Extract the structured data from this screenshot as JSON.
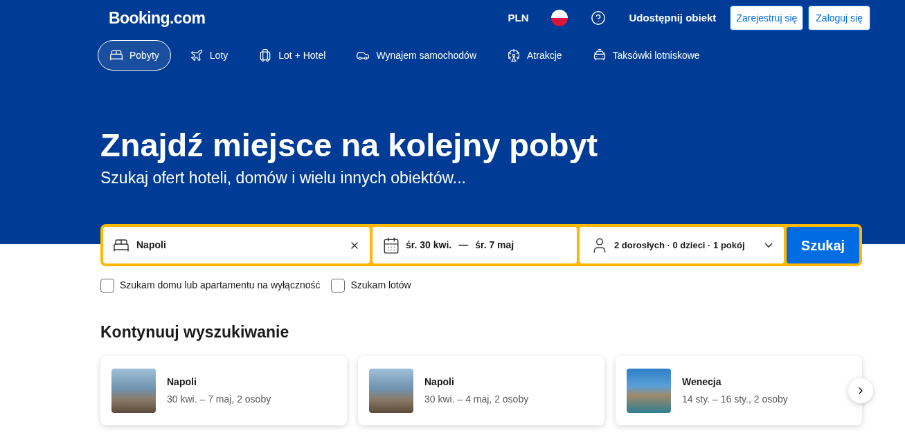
{
  "header": {
    "logo": "Booking.com",
    "currency": "PLN",
    "list_property": "Udostępnij obiekt",
    "register": "Zarejestruj się",
    "login": "Zaloguj się"
  },
  "nav": [
    {
      "label": "Pobyty",
      "kind": "stays",
      "selected": true
    },
    {
      "label": "Loty",
      "kind": "flights",
      "selected": false
    },
    {
      "label": "Lot + Hotel",
      "kind": "package",
      "selected": false
    },
    {
      "label": "Wynajem samochodów",
      "kind": "cars",
      "selected": false
    },
    {
      "label": "Atrakcje",
      "kind": "attractions",
      "selected": false
    },
    {
      "label": "Taksówki lotniskowe",
      "kind": "taxi",
      "selected": false
    }
  ],
  "hero": {
    "title": "Znajdź miejsce na kolejny pobyt",
    "subtitle": "Szukaj ofert hoteli, domów i wielu innych obiektów..."
  },
  "search": {
    "destination": "Napoli",
    "check_in": "śr. 30 kwi.",
    "separator": "—",
    "check_out": "śr. 7 maj",
    "guests": "2 dorosłych · 0 dzieci · 1 pokój",
    "button": "Szukaj"
  },
  "options": [
    {
      "label": "Szukam domu lub apartamentu na wyłączność",
      "checked": false
    },
    {
      "label": "Szukam lotów",
      "checked": false
    }
  ],
  "recent": {
    "title": "Kontynuuj wyszukiwanie",
    "items": [
      {
        "name": "Napoli",
        "details": "30 kwi. – 7 maj, 2 osoby",
        "kind": "coast"
      },
      {
        "name": "Napoli",
        "details": "30 kwi. – 4 maj, 2 osoby",
        "kind": "coast"
      },
      {
        "name": "Wenecja",
        "details": "14 sty. – 16 sty., 2 osoby",
        "kind": "canal"
      }
    ]
  }
}
